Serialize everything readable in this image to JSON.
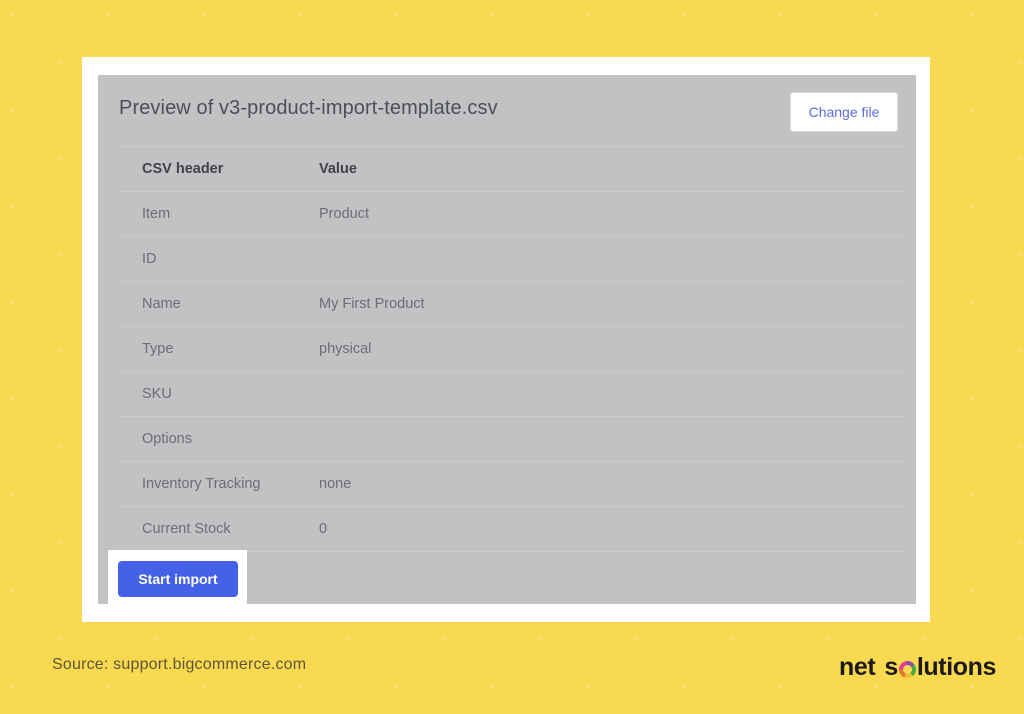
{
  "background": {
    "color": "#f9d94f"
  },
  "screenshot": {
    "panel": {
      "title": "Preview of v3-product-import-template.csv",
      "change_file_label": "Change file",
      "change_file_color": "#5b6bdf",
      "table": {
        "columns": [
          "CSV header",
          "Value"
        ],
        "rows": [
          {
            "key": "Item",
            "value": "Product"
          },
          {
            "key": "ID",
            "value": ""
          },
          {
            "key": "Name",
            "value": "My First Product"
          },
          {
            "key": "Type",
            "value": "physical"
          },
          {
            "key": "SKU",
            "value": ""
          },
          {
            "key": "Options",
            "value": ""
          },
          {
            "key": "Inventory Tracking",
            "value": "none"
          },
          {
            "key": "Current Stock",
            "value": "0"
          }
        ]
      },
      "start_import_label": "Start import",
      "start_import_color": "#4461e8"
    }
  },
  "footer": {
    "source": "Source: support.bigcommerce.com",
    "logo": {
      "word_one": "net",
      "s": "s",
      "rest": "lutions"
    }
  }
}
